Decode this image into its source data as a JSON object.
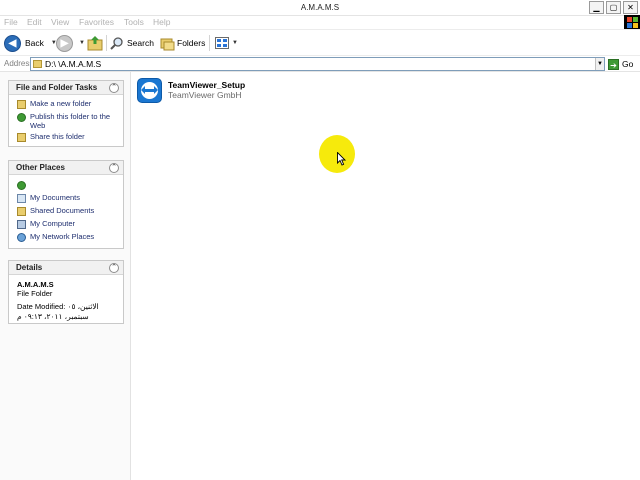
{
  "window": {
    "title": "A.M.A.M.S",
    "buttons": {
      "minimize": "▁",
      "maximize": "▢",
      "close": "✕"
    }
  },
  "menu": [
    "File",
    "Edit",
    "View",
    "Favorites",
    "Tools",
    "Help"
  ],
  "toolbar": {
    "back_label": "Back",
    "search_label": "Search",
    "folders_label": "Folders"
  },
  "address": {
    "label": "Address",
    "value": "D:\\ \\A.M.A.M.S",
    "go_label": "Go"
  },
  "tasks_panel": {
    "title": "File and Folder Tasks",
    "items": [
      {
        "label": "Make a new folder",
        "icon": "new-folder-icon"
      },
      {
        "label": "Publish this folder to the Web",
        "icon": "publish-web-icon"
      },
      {
        "label": "Share this folder",
        "icon": "share-folder-icon"
      }
    ]
  },
  "places_panel": {
    "title": "Other Places",
    "items": [
      {
        "label": "",
        "icon": "network-globe-icon"
      },
      {
        "label": "My Documents",
        "icon": "my-documents-icon"
      },
      {
        "label": "Shared Documents",
        "icon": "shared-documents-icon"
      },
      {
        "label": "My Computer",
        "icon": "my-computer-icon"
      },
      {
        "label": "My Network Places",
        "icon": "network-places-icon"
      }
    ]
  },
  "details_panel": {
    "title": "Details",
    "name": "A.M.A.M.S",
    "type": "File Folder",
    "date_line1": "Date Modified: الاثنين، ٠٥",
    "date_line2": "سبتمبر، ٢٠١١، ٠٩:١٣ م"
  },
  "files": [
    {
      "name": "TeamViewer_Setup",
      "publisher": "TeamViewer GmbH",
      "icon": "teamviewer-icon"
    }
  ],
  "colors": {
    "task_link": "#1f2f6f",
    "cursor_highlight": "#f6ea0c",
    "back_button": "#2b6db8"
  }
}
